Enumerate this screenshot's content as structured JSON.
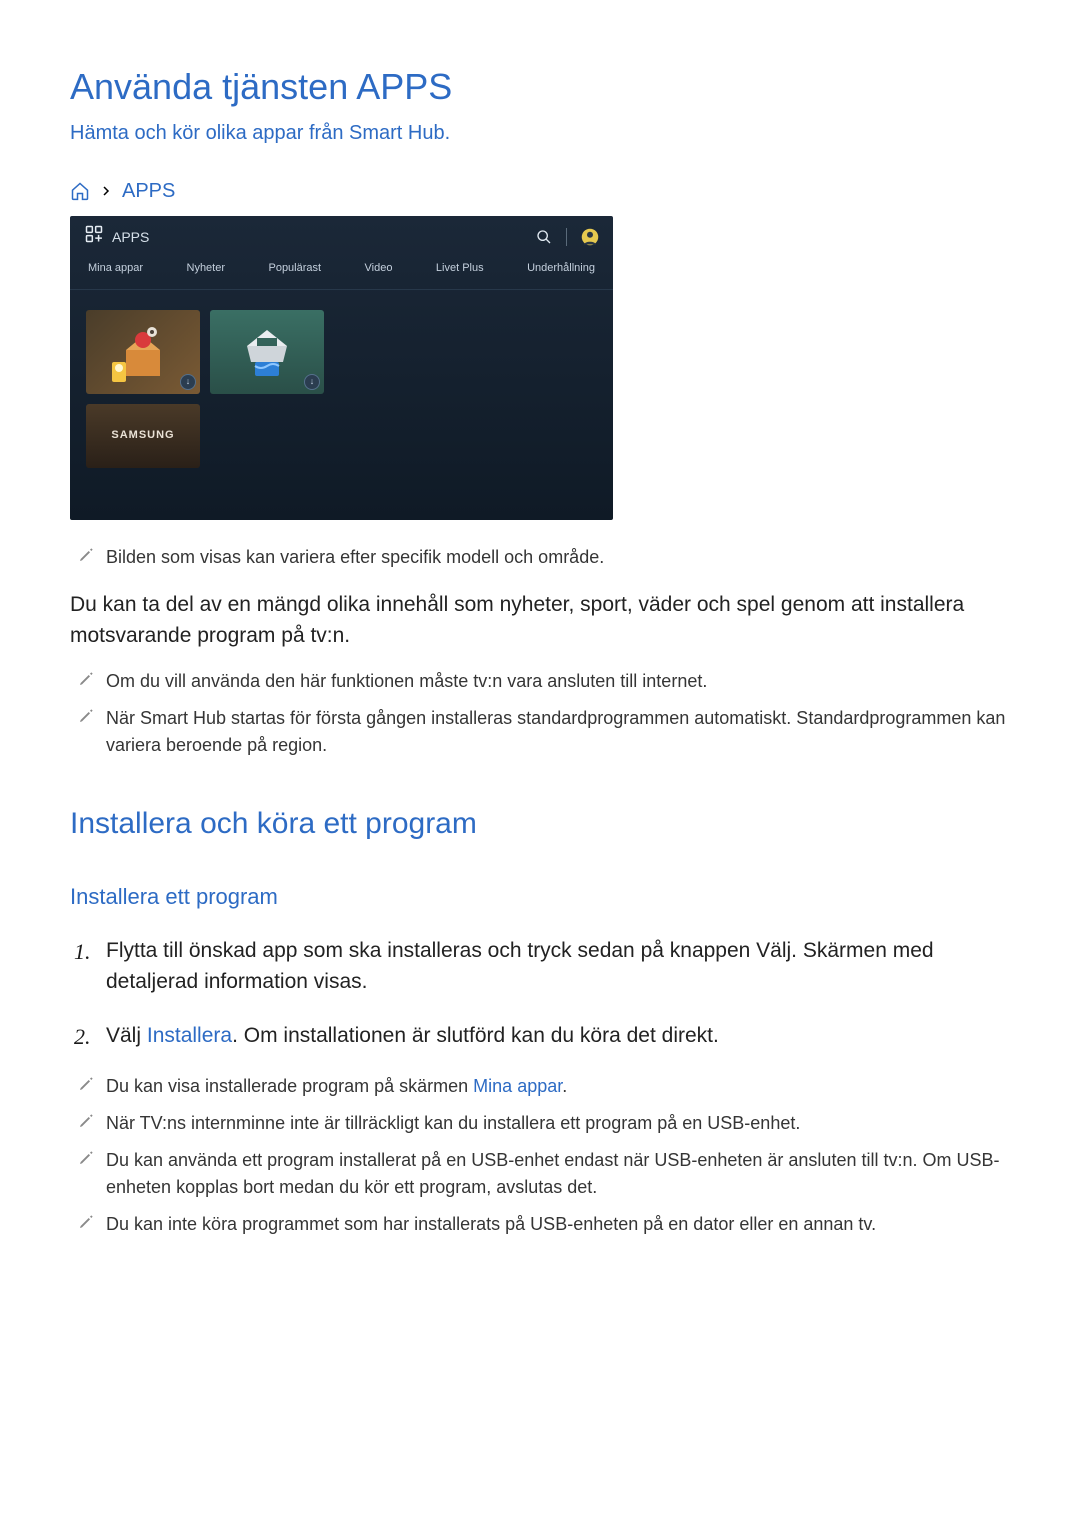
{
  "title": "Använda tjänsten APPS",
  "subtitle": "Hämta och kör olika appar från Smart Hub.",
  "breadcrumb": {
    "label": "APPS"
  },
  "apps_screen": {
    "header_label": "APPS",
    "tabs": [
      "Mina appar",
      "Nyheter",
      "Populärast",
      "Video",
      "Livet Plus",
      "Underhållning"
    ],
    "samsung_label": "SAMSUNG",
    "badge_glyph": "↓"
  },
  "notes_top": [
    "Bilden som visas kan variera efter specifik modell och område."
  ],
  "paragraph": "Du kan ta del av en mängd olika innehåll som nyheter, sport, väder och spel genom att installera motsvarande program på tv:n.",
  "notes_mid": [
    "Om du vill använda den här funktionen måste tv:n vara ansluten till internet.",
    "När Smart Hub startas för första gången installeras standardprogrammen automatiskt. Standardprogrammen kan variera beroende på region."
  ],
  "h2": "Installera och köra ett program",
  "h3": "Installera ett program",
  "steps": {
    "s1": "Flytta till önskad app som ska installeras och tryck sedan på knappen Välj. Skärmen med detaljerad information visas.",
    "s2_a": "Välj ",
    "s2_link": "Installera",
    "s2_b": ". Om installationen är slutförd kan du köra det direkt."
  },
  "notes_bottom": {
    "n1_a": "Du kan visa installerade program på skärmen ",
    "n1_link": "Mina appar",
    "n1_b": ".",
    "n2": "När TV:ns internminne inte är tillräckligt kan du installera ett program på en USB-enhet.",
    "n3": "Du kan använda ett program installerat på en USB-enhet endast när USB-enheten är ansluten till tv:n. Om USB-enheten kopplas bort medan du kör ett program, avslutas det.",
    "n4": "Du kan inte köra programmet som har installerats på USB-enheten på en dator eller en annan tv."
  }
}
